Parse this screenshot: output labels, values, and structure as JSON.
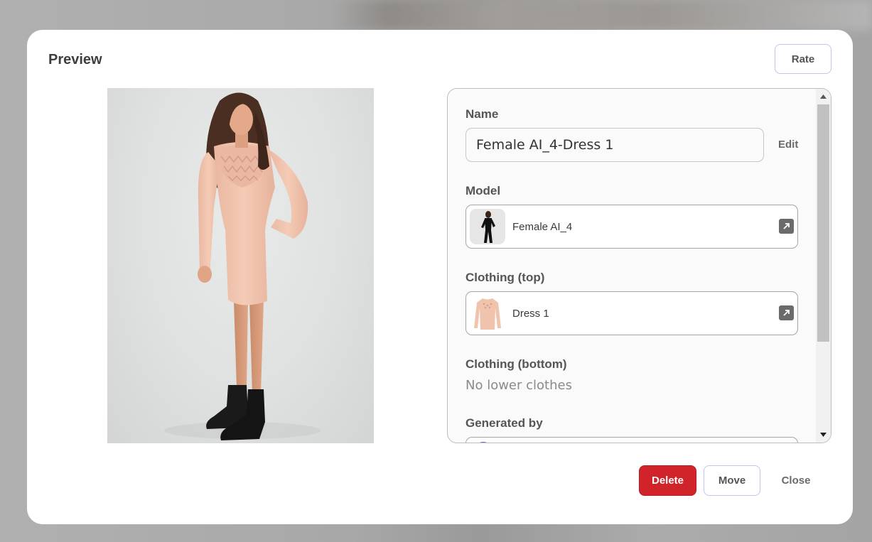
{
  "modal": {
    "title": "Preview",
    "rate_label": "Rate"
  },
  "details": {
    "name_label": "Name",
    "name_value": "Female AI_4-Dress 1",
    "edit_label": "Edit",
    "model_label": "Model",
    "model_value": "Female AI_4",
    "clothing_top_label": "Clothing (top)",
    "clothing_top_value": "Dress 1",
    "clothing_bottom_label": "Clothing (bottom)",
    "clothing_bottom_value": "No lower clothes",
    "generated_by_label": "Generated by"
  },
  "actions": {
    "delete_label": "Delete",
    "move_label": "Move",
    "close_label": "Close"
  },
  "colors": {
    "accent_delete": "#d0242a",
    "button_border": "#c5c2ee",
    "dress": "#f0c3ad",
    "backdrop": "#a9a9a9"
  },
  "icons": {
    "open": "external-link-icon",
    "scroll_up": "scroll-up-arrow-icon",
    "scroll_down": "scroll-down-arrow-icon"
  }
}
